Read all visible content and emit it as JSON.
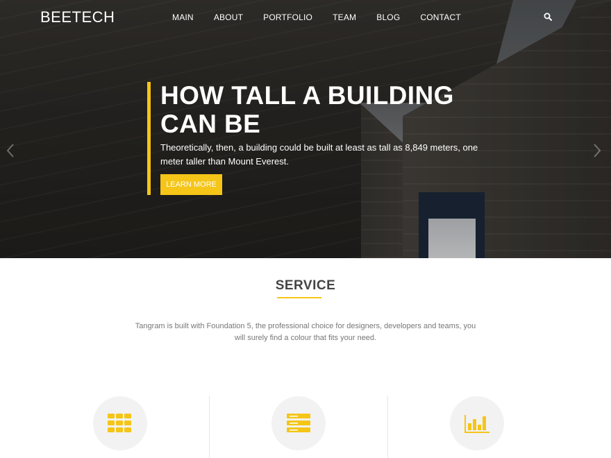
{
  "header": {
    "logo": "BEETECH",
    "nav": [
      "MAIN",
      "ABOUT",
      "PORTFOLIO",
      "TEAM",
      "BLOG",
      "CONTACT"
    ],
    "search_icon": "search-icon"
  },
  "hero": {
    "title_line1": "HOW TALL A BUILDING",
    "title_line2": "CAN BE",
    "text_line1": "Theoretically, then, a building could be built at least as tall as 8,849 meters, one",
    "text_line2": "meter taller than Mount Everest.",
    "button": "LEARN MORE",
    "prev_icon": "chevron-left-icon",
    "next_icon": "chevron-right-icon"
  },
  "service": {
    "title": "SERVICE",
    "desc_line1": "Tangram is built with Foundation 5, the professional choice for designers, developers and teams, you",
    "desc_line2": "will surely find a colour that fits your need.",
    "icons": [
      "grid-icon",
      "server-icon",
      "bar-chart-icon"
    ]
  },
  "colors": {
    "accent": "#f5c518",
    "text_dark": "#444444",
    "text_muted": "#777777"
  }
}
